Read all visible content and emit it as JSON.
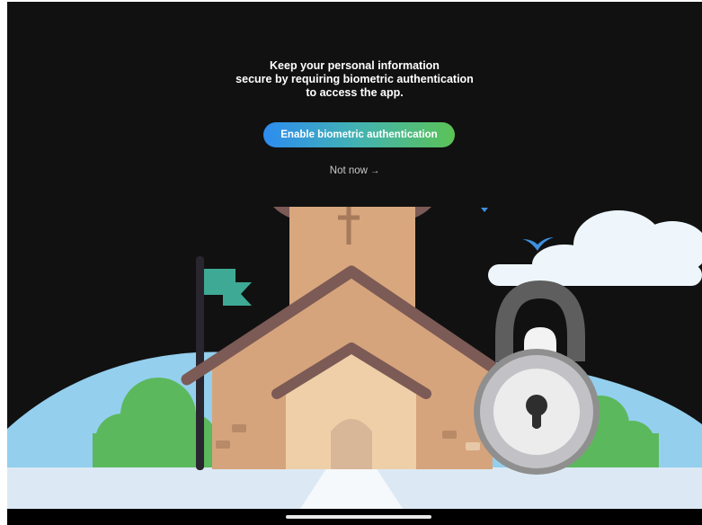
{
  "screen": {
    "message": [
      "Keep your personal information",
      "secure by requiring biometric authentication",
      "to access the app."
    ],
    "enable_button_label": "Enable biometric authentication",
    "not_now_label": "Not now",
    "not_now_arrow": "→"
  },
  "colors": {
    "background": "#111111",
    "button_gradient_start": "#2d8cf0",
    "button_gradient_end": "#5bc356",
    "secondary_text": "#c9c9c9"
  },
  "icons": [
    "church-illustration",
    "padlock-icon",
    "flag-icon",
    "cloud-icon",
    "bird-icon"
  ]
}
